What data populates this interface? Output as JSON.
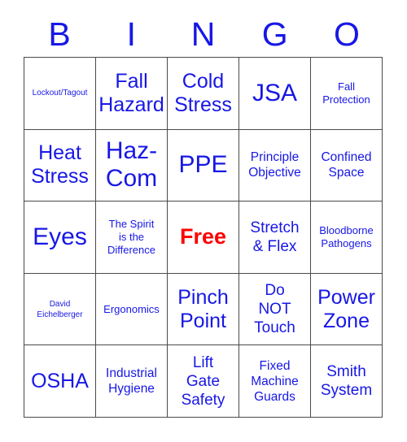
{
  "card": {
    "header_letters": [
      "B",
      "I",
      "N",
      "G",
      "O"
    ],
    "columns": 5,
    "rows": 5,
    "colors": {
      "text_blue": "#1717e6",
      "free_red": "#fd0000",
      "grid_line": "#4a4a4a",
      "background": "#ffffff"
    },
    "cells": [
      {
        "text": "Lockout/Tagout",
        "size": "xs",
        "free": false
      },
      {
        "text": "Fall\nHazard",
        "size": "xl",
        "free": false
      },
      {
        "text": "Cold\nStress",
        "size": "xl",
        "free": false
      },
      {
        "text": "JSA",
        "size": "xxl",
        "free": false
      },
      {
        "text": "Fall\nProtection",
        "size": "s",
        "free": false
      },
      {
        "text": "Heat\nStress",
        "size": "xl",
        "free": false
      },
      {
        "text": "Haz-\nCom",
        "size": "xxl",
        "free": false
      },
      {
        "text": "PPE",
        "size": "xxl",
        "free": false
      },
      {
        "text": "Principle\nObjective",
        "size": "m",
        "free": false
      },
      {
        "text": "Confined\nSpace",
        "size": "m",
        "free": false
      },
      {
        "text": "Eyes",
        "size": "xxl",
        "free": false
      },
      {
        "text": "The Spirit\nis the\nDifference",
        "size": "s",
        "free": false
      },
      {
        "text": "Free",
        "size": "xl",
        "free": true
      },
      {
        "text": "Stretch\n& Flex",
        "size": "l",
        "free": false
      },
      {
        "text": "Bloodborne\nPathogens",
        "size": "s",
        "free": false
      },
      {
        "text": "David\nEichelberger",
        "size": "xs",
        "free": false
      },
      {
        "text": "Ergonomics",
        "size": "s",
        "free": false
      },
      {
        "text": "Pinch\nPoint",
        "size": "xl",
        "free": false
      },
      {
        "text": "Do\nNOT\nTouch",
        "size": "l",
        "free": false
      },
      {
        "text": "Power\nZone",
        "size": "xl",
        "free": false
      },
      {
        "text": "OSHA",
        "size": "xl",
        "free": false
      },
      {
        "text": "Industrial\nHygiene",
        "size": "m",
        "free": false
      },
      {
        "text": "Lift\nGate\nSafety",
        "size": "l",
        "free": false
      },
      {
        "text": "Fixed\nMachine\nGuards",
        "size": "m",
        "free": false
      },
      {
        "text": "Smith\nSystem",
        "size": "l",
        "free": false
      }
    ]
  }
}
